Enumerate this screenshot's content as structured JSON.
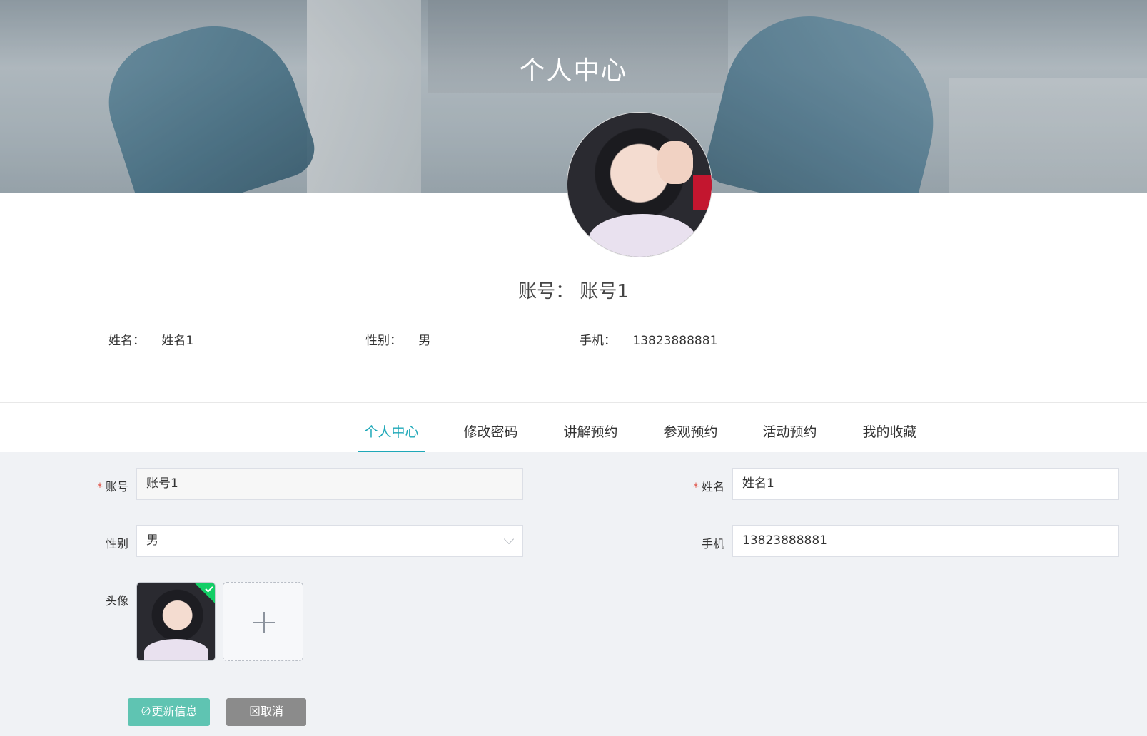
{
  "banner": {
    "title": "个人中心"
  },
  "profile": {
    "account_label": "账号：",
    "account_value": "账号1",
    "name_label": "姓名：",
    "name_value": "姓名1",
    "gender_label": "性别：",
    "gender_value": "男",
    "phone_label": "手机：",
    "phone_value": "13823888881"
  },
  "tabs": [
    {
      "label": "个人中心",
      "active": true
    },
    {
      "label": "修改密码"
    },
    {
      "label": "讲解预约"
    },
    {
      "label": "参观预约"
    },
    {
      "label": "活动预约"
    },
    {
      "label": "我的收藏"
    }
  ],
  "form": {
    "required_mark": "*",
    "account_label": "账号",
    "account_value": "账号1",
    "name_label": "姓名",
    "name_value": "姓名1",
    "gender_label": "性别",
    "gender_value": "男",
    "phone_label": "手机",
    "phone_value": "13823888881",
    "avatar_label": "头像",
    "submit_label": "更新信息",
    "cancel_label": "取消"
  },
  "icons": {
    "submit": "check-circle-icon",
    "cancel": "close-square-icon",
    "upload": "plus-icon",
    "select": "chevron-down-icon"
  },
  "colors": {
    "accent": "#1fa8b8",
    "primary_button": "#5fc4b2",
    "cancel_button": "#8b8b8b",
    "required": "#e05a4f",
    "upload_success": "#13ce66"
  }
}
